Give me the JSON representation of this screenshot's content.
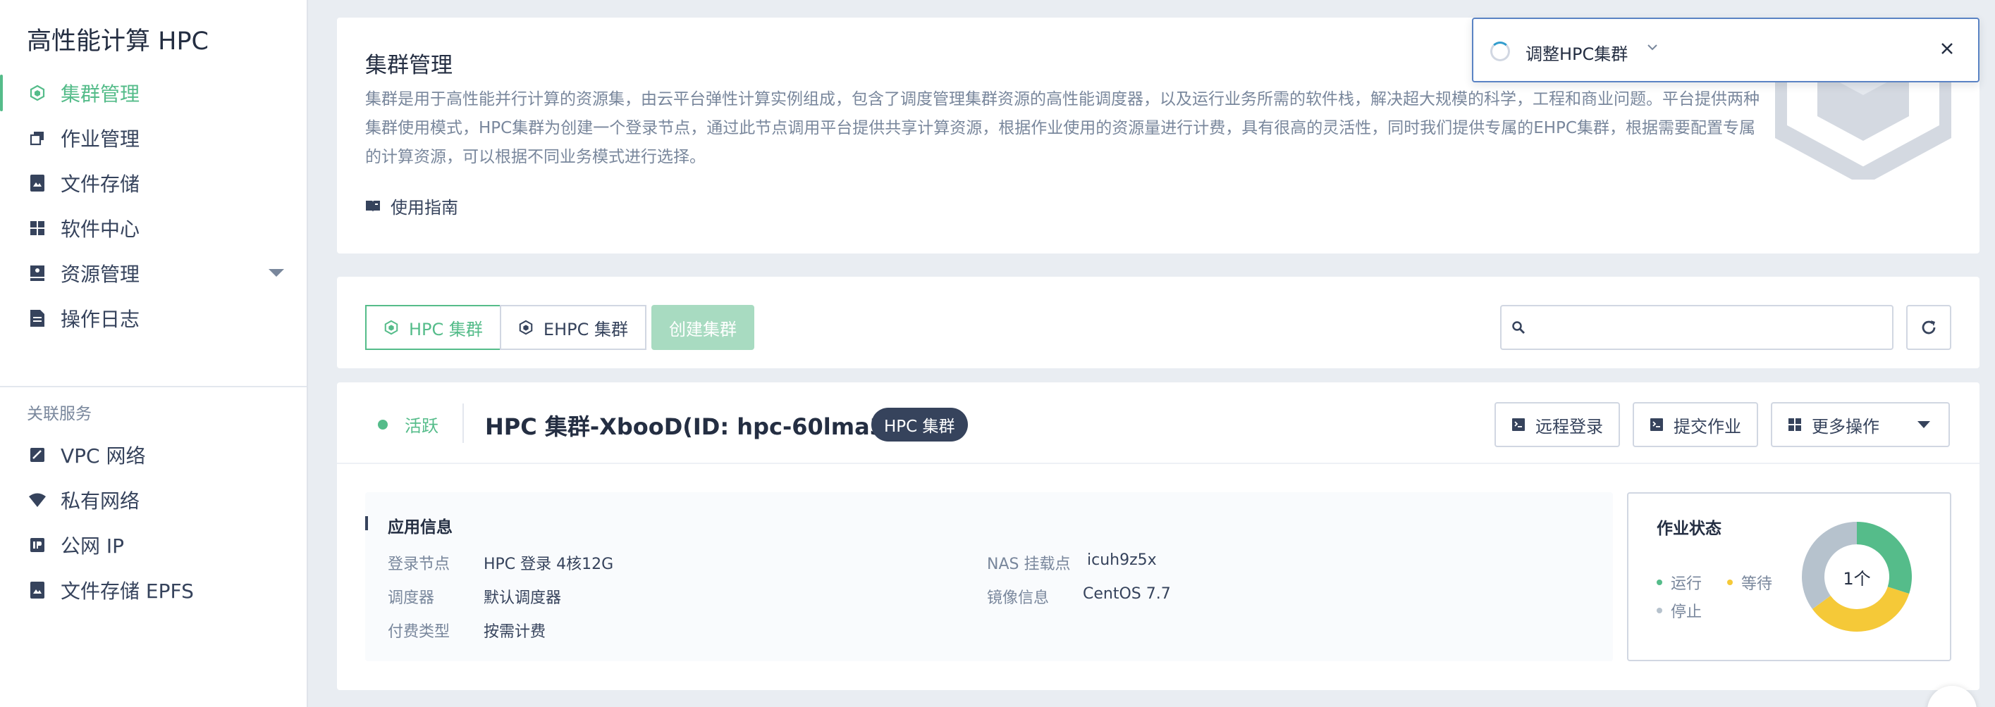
{
  "sidebar": {
    "app_title": "高性能计算 HPC",
    "nav": [
      {
        "label": "集群管理",
        "icon": "cluster-icon",
        "active": true
      },
      {
        "label": "作业管理",
        "icon": "jobs-icon"
      },
      {
        "label": "文件存储",
        "icon": "file-storage-icon"
      },
      {
        "label": "软件中心",
        "icon": "apps-icon"
      },
      {
        "label": "资源管理",
        "icon": "resource-icon",
        "expandable": true
      },
      {
        "label": "操作日志",
        "icon": "log-icon"
      }
    ],
    "related_label": "关联服务",
    "related": [
      {
        "label": "VPC 网络",
        "icon": "vpc-icon"
      },
      {
        "label": "私有网络",
        "icon": "wifi-icon"
      },
      {
        "label": "公网 IP",
        "icon": "ip-icon"
      },
      {
        "label": "文件存储 EPFS",
        "icon": "epfs-icon"
      }
    ]
  },
  "intro": {
    "title": "集群管理",
    "description": "集群是用于高性能并行计算的资源集，由云平台弹性计算实例组成，包含了调度管理集群资源的高性能调度器，以及运行业务所需的软件栈，解决超大规模的科学，工程和商业问题。平台提供两种集群使用模式，HPC集群为创建一个登录节点，通过此节点调用平台提供共享计算资源，根据作业使用的资源量进行计费，具有很高的灵活性，同时我们提供专属的EHPC集群，根据需要配置专属的计算资源，可以根据不同业务模式进行选择。",
    "guide_label": "使用指南"
  },
  "toolbar": {
    "tabs": [
      {
        "label": "HPC 集群",
        "active": true
      },
      {
        "label": "EHPC 集群",
        "active": false
      }
    ],
    "create_label": "创建集群",
    "search_placeholder": ""
  },
  "cluster": {
    "status": "活跃",
    "name": "HPC 集群-XbooD(ID: hpc-60lma3xx)",
    "type_badge": "HPC 集群",
    "actions": {
      "remote_login": "远程登录",
      "submit_job": "提交作业",
      "more": "更多操作"
    },
    "info": {
      "title": "应用信息",
      "login_node_key": "登录节点",
      "login_node_val": "HPC 登录 4核12G",
      "scheduler_key": "调度器",
      "scheduler_val": "默认调度器",
      "billing_key": "付费类型",
      "billing_val": "按需计费",
      "nas_key": "NAS 挂载点",
      "nas_val": "icuh9z5x",
      "image_key": "镜像信息",
      "image_val": "CentOS 7.7"
    },
    "jobs": {
      "title": "作业状态",
      "running": "运行",
      "waiting": "等待",
      "stopped": "停止",
      "center_label": "1个",
      "donut_shares": {
        "running": 0.3,
        "waiting": 0.35,
        "stopped": 0.35
      }
    }
  },
  "notice": {
    "text": "调整HPC集群"
  },
  "colors": {
    "accent": "#55bc8a",
    "running": "#55bc8a",
    "waiting": "#f5c938",
    "stopped": "#b6c2cd",
    "dark": "#36435c"
  }
}
